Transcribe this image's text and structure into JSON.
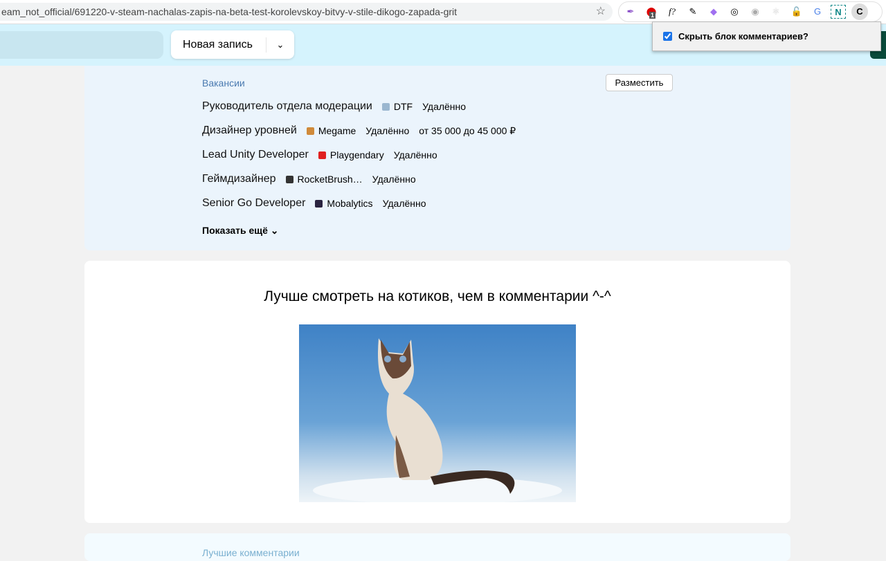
{
  "browser": {
    "url": "eam_not_official/691220-v-steam-nachalas-zapis-na-beta-test-korolevskoy-bitvy-v-stile-dikogo-zapada-grit",
    "badge": "1",
    "profile": "C"
  },
  "popup": {
    "label": "Скрыть блок комментариев?",
    "checked": true
  },
  "header": {
    "new_post": "Новая запись"
  },
  "vacancies": {
    "title": "Вакансии",
    "place_button": "Разместить",
    "items": [
      {
        "title": "Руководитель отдела модерации",
        "company": "DTF",
        "location": "Удалённо",
        "salary": "",
        "logo_color": "#9bb7d0"
      },
      {
        "title": "Дизайнер уровней",
        "company": "Megame",
        "location": "Удалённо",
        "salary": "от 35 000 до 45 000 ₽",
        "logo_color": "#d08a3a"
      },
      {
        "title": "Lead Unity Developer",
        "company": "Playgendary",
        "location": "Удалённо",
        "salary": "",
        "logo_color": "#e02020"
      },
      {
        "title": "Геймдизайнер",
        "company": "RocketBrush…",
        "location": "Удалённо",
        "salary": "",
        "logo_color": "#333"
      },
      {
        "title": "Senior Go Developer",
        "company": "Mobalytics",
        "location": "Удалённо",
        "salary": "",
        "logo_color": "#2a2440"
      }
    ],
    "show_more": "Показать ещё"
  },
  "post": {
    "title": "Лучше смотреть на котиков, чем в комментарии ^-^"
  },
  "comments": {
    "title": "Лучшие комментарии"
  }
}
